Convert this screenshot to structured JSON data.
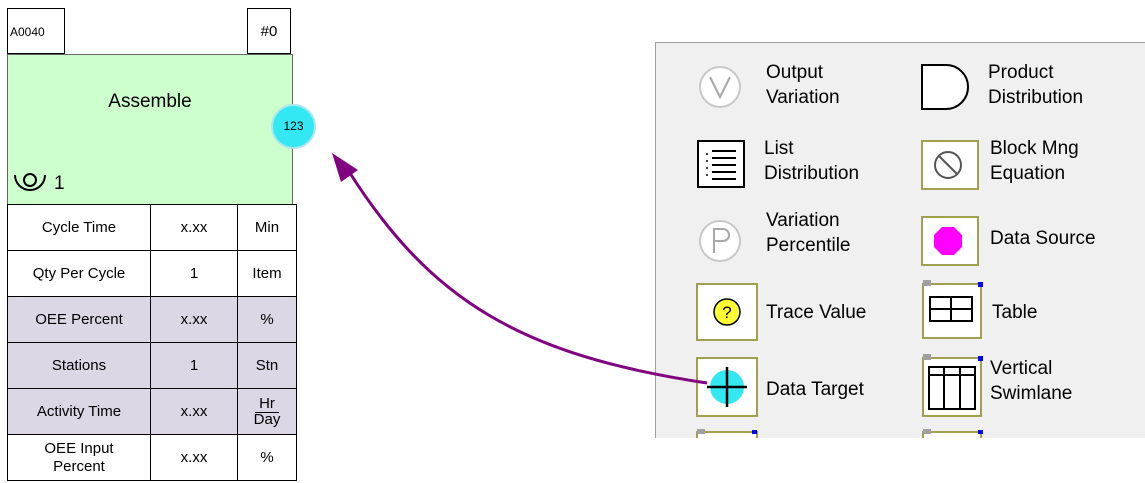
{
  "block": {
    "id": "A0040",
    "number": "#0",
    "title": "Assemble",
    "level": "1",
    "badge": "123",
    "rows": [
      {
        "label": "Cycle Time",
        "value": "x.xx",
        "unit": "Min",
        "style": "white"
      },
      {
        "label": "Qty Per Cycle",
        "value": "1",
        "unit": "Item",
        "style": "white"
      },
      {
        "label": "OEE Percent",
        "value": "x.xx",
        "unit": "%",
        "style": "purple"
      },
      {
        "label": "Stations",
        "value": "1",
        "unit": "Stn",
        "style": "purple"
      },
      {
        "label": "Activity Time",
        "value": "x.xx",
        "unit_num": "Hr",
        "unit_den": "Day",
        "style": "purple"
      },
      {
        "label_line1": "OEE Input",
        "label_line2": "Percent",
        "value": "x.xx",
        "unit": "%",
        "style": "white"
      }
    ]
  },
  "palette": {
    "items": [
      {
        "line1": "Output",
        "line2": "Variation",
        "icon": "output-variation-icon"
      },
      {
        "line1": "Product",
        "line2": "Distribution",
        "icon": "product-distribution-icon"
      },
      {
        "line1": "List",
        "line2": "Distribution",
        "icon": "list-distribution-icon"
      },
      {
        "line1": "Block Mng",
        "line2": "Equation",
        "icon": "block-mng-equation-icon"
      },
      {
        "line1": "Variation",
        "line2": "Percentile",
        "icon": "variation-percentile-icon"
      },
      {
        "line1": "Data Source",
        "icon": "data-source-icon"
      },
      {
        "line1": "Trace Value",
        "icon": "trace-value-icon"
      },
      {
        "line1": "Table",
        "icon": "table-icon"
      },
      {
        "line1": "Data Target",
        "icon": "data-target-icon"
      },
      {
        "line1": "Vertical",
        "line2": "Swimlane",
        "icon": "vertical-swimlane-icon"
      }
    ]
  },
  "colors": {
    "block_green": "#ccffcc",
    "row_purple": "#dcd6e5",
    "badge_cyan": "#33e8f2",
    "arrow_purple": "#800080",
    "icon_border_olive": "#a0a050",
    "data_source_magenta": "#ff00ff"
  }
}
